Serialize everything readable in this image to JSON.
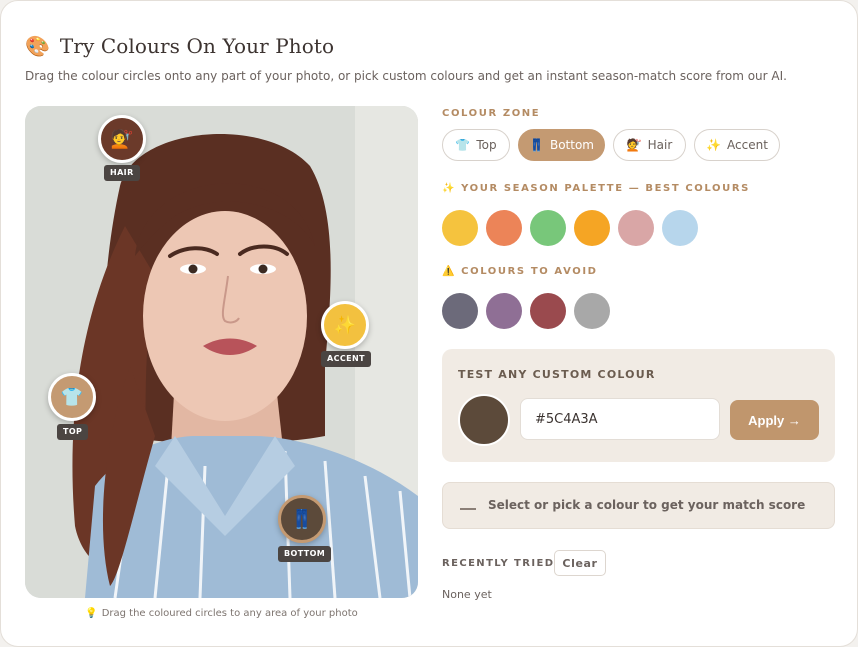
{
  "header": {
    "emoji": "🎨",
    "title": "Try Colours On Your Photo",
    "subtitle": "Drag the colour circles onto any part of your photo, or pick custom colours and get an instant season-match score from our AI."
  },
  "photo": {
    "hint": "Drag the coloured circles to any area of your photo",
    "chips": [
      {
        "label": "HAIR",
        "color": "#6b3a2a",
        "icon": "hair-icon"
      },
      {
        "label": "ACCENT",
        "color": "#f3c13f",
        "icon": "sparkle-icon"
      },
      {
        "label": "TOP",
        "color": "#c49a72",
        "icon": "shirt-icon"
      },
      {
        "label": "BOTTOM",
        "color": "#5c4a3a",
        "icon": "jeans-icon"
      }
    ]
  },
  "zone": {
    "label": "COLOUR ZONE",
    "buttons": [
      {
        "label": "Top",
        "icon": "shirt-icon",
        "active": false
      },
      {
        "label": "Bottom",
        "icon": "jeans-icon",
        "active": true
      },
      {
        "label": "Hair",
        "icon": "hair-icon",
        "active": false
      },
      {
        "label": "Accent",
        "icon": "sparkle-icon",
        "active": false
      }
    ]
  },
  "palette": {
    "label": "YOUR SEASON PALETTE — BEST COLOURS",
    "icon": "sparkle-icon",
    "colors": [
      "#f5c33e",
      "#ec8458",
      "#78c77a",
      "#f5a524",
      "#d9a6a6",
      "#b7d6ec"
    ]
  },
  "avoid": {
    "label": "COLOURS TO AVOID",
    "icon": "warning-icon",
    "colors": [
      "#6c6a7a",
      "#8f6f95",
      "#9a4a4e",
      "#a8a8a8"
    ]
  },
  "custom": {
    "title": "TEST ANY CUSTOM COLOUR",
    "hex": "#5C4A3A",
    "swatch_color": "#5c4a3a",
    "apply_label": "Apply →"
  },
  "score": {
    "text": "Select or pick a colour to get your match score"
  },
  "recent": {
    "label": "RECENTLY TRIED",
    "clear_label": "Clear",
    "empty_text": "None yet"
  }
}
